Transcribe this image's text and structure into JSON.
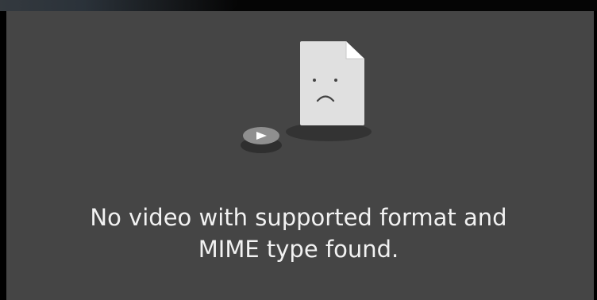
{
  "player": {
    "error_message": "No video with supported format and\nMIME type found.",
    "icons": {
      "file": "broken-file-sad-icon",
      "play": "play-icon"
    },
    "colors": {
      "background": "#454545",
      "text": "#f2f2f2",
      "file": "#e0e0e0"
    }
  }
}
